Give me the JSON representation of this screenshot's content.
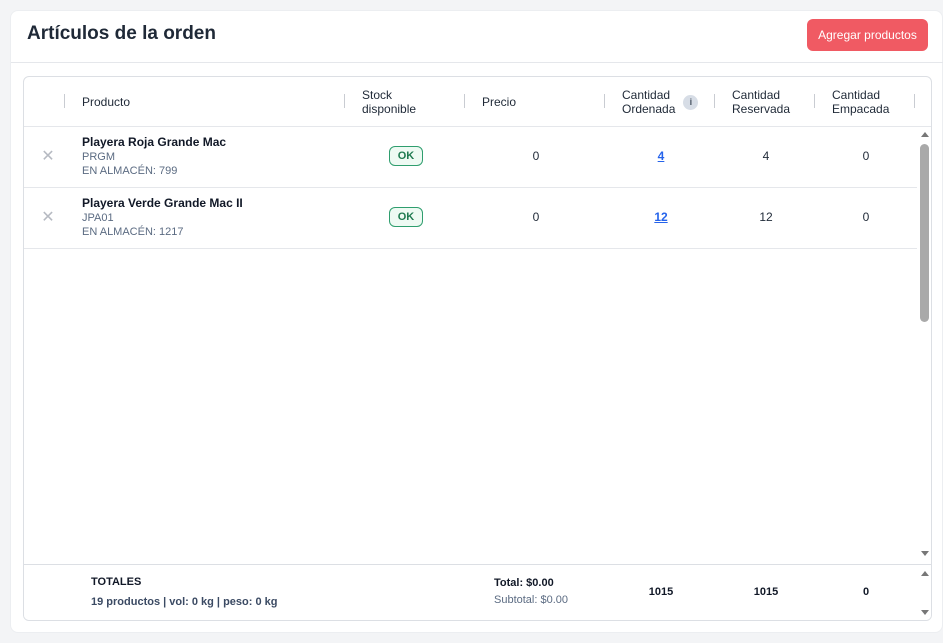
{
  "header": {
    "title": "Artículos de la orden",
    "add_button": "Agregar productos"
  },
  "columns": {
    "product": "Producto",
    "stock_line1": "Stock",
    "stock_line2": "disponible",
    "price": "Precio",
    "ordered_line1": "Cantidad",
    "ordered_line2": "Ordenada",
    "ordered_info": "i",
    "reserved_line1": "Cantidad",
    "reserved_line2": "Reservada",
    "packed_line1": "Cantidad",
    "packed_line2": "Empacada"
  },
  "rows": [
    {
      "remove": "✕",
      "name": "Playera Roja Grande Mac",
      "sku": "PRGM",
      "stock": "EN ALMACÉN: 799",
      "status": "OK",
      "price": "0",
      "ordered": "4",
      "reserved": "4",
      "packed": "0"
    },
    {
      "remove": "✕",
      "name": "Playera Verde Grande Mac II",
      "sku": "JPA01",
      "stock": "EN ALMACÉN: 1217",
      "status": "OK",
      "price": "0",
      "ordered": "12",
      "reserved": "12",
      "packed": "0"
    }
  ],
  "totals": {
    "label": "TOTALES",
    "detail": "19 productos | vol: 0 kg | peso: 0 kg",
    "total": "Total: $0.00",
    "subtotal": "Subtotal: $0.00",
    "ordered": "1015",
    "reserved": "1015",
    "packed": "0"
  },
  "colors": {
    "accent": "#f05a63",
    "link": "#2563eb",
    "ok": "#2f9e6e"
  },
  "icons": {
    "remove": "close-icon",
    "info": "info-icon"
  }
}
